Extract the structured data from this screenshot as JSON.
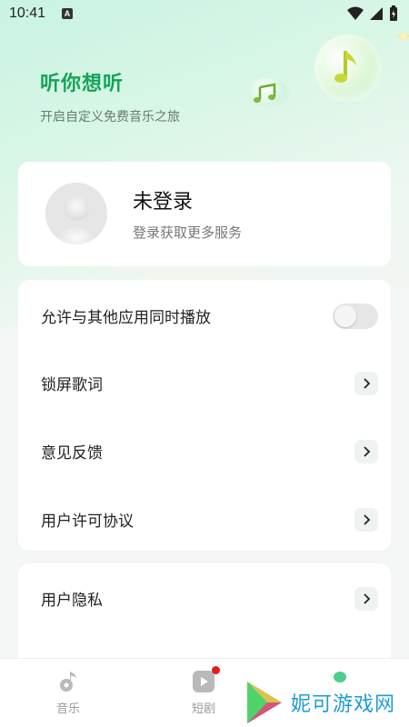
{
  "status_bar": {
    "time": "10:41",
    "indicator": "A"
  },
  "hero": {
    "title": "听你想听",
    "subtitle": "开启自定义免费音乐之旅",
    "decorations": [
      "music-note-bubble-icon",
      "music-notes-bubble-icon"
    ]
  },
  "profile": {
    "name": "未登录",
    "hint": "登录获取更多服务",
    "avatar_icon": "default-avatar-icon"
  },
  "settings": {
    "items": [
      {
        "label": "允许与其他应用同时播放",
        "control": "toggle",
        "toggle_on": false
      },
      {
        "label": "锁屏歌词",
        "control": "chevron"
      },
      {
        "label": "意见反馈",
        "control": "chevron"
      },
      {
        "label": "用户许可协议",
        "control": "chevron"
      }
    ]
  },
  "settings2": {
    "items": [
      {
        "label": "用户隐私",
        "control": "chevron"
      }
    ]
  },
  "tabbar": {
    "tabs": [
      {
        "label": "音乐",
        "icon": "music-note-icon"
      },
      {
        "label": "短剧",
        "icon": "play-video-icon",
        "badge": true
      },
      {
        "label": "",
        "icon": "green-dot-icon"
      }
    ]
  },
  "watermark": {
    "text": "妮可游戏网"
  },
  "colors": {
    "accent": "#17a35a",
    "badge": "#e21b1b",
    "watermark": "#1f9bd9"
  }
}
